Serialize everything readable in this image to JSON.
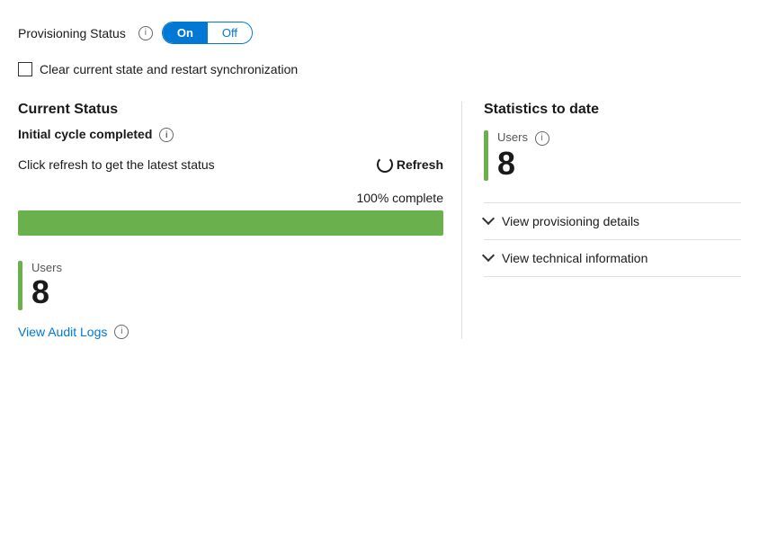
{
  "provisioning": {
    "status_label": "Provisioning Status",
    "info_icon": "i",
    "toggle_on": "On",
    "toggle_off": "Off"
  },
  "checkbox": {
    "label": "Clear current state and restart synchronization"
  },
  "current_status": {
    "title": "Current Status",
    "cycle_label": "Initial cycle completed",
    "refresh_hint": "Click refresh to get the latest status",
    "refresh_label": "Refresh",
    "progress_text": "100% complete",
    "progress_percent": 100
  },
  "users_bottom": {
    "bar_label": "Users",
    "count": "8"
  },
  "audit": {
    "link_label": "View Audit Logs",
    "info_icon": "i"
  },
  "stats": {
    "title": "Statistics to date",
    "users_label": "Users",
    "users_info_icon": "i",
    "users_count": "8"
  },
  "collapsible": {
    "provisioning_details": "View provisioning details",
    "technical_info": "View technical information"
  }
}
